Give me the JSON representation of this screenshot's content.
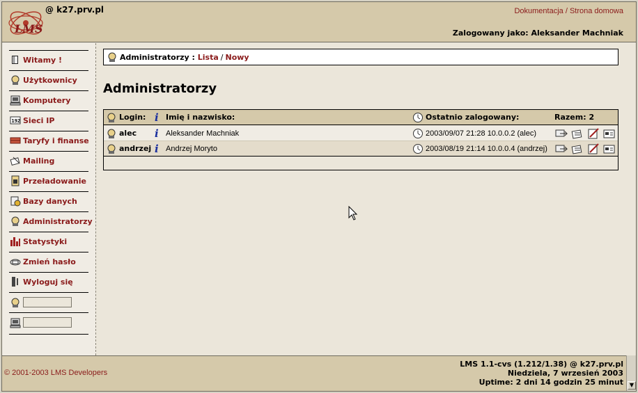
{
  "header": {
    "hostname": "@ k27.prv.pl",
    "links": [
      {
        "label": "Dokumentacja"
      },
      {
        "label": "Strona domowa"
      }
    ],
    "separator": "/",
    "logged_in": "Zalogowany jako: Aleksander Machniak",
    "logo_text": "LMS"
  },
  "sidebar": {
    "items": [
      {
        "label": "Witamy !",
        "icon": "book-icon"
      },
      {
        "label": "Użytkownicy",
        "icon": "user-icon"
      },
      {
        "label": "Komputery",
        "icon": "computer-icon"
      },
      {
        "label": "Sieci IP",
        "icon": "network-icon"
      },
      {
        "label": "Taryfy i finanse",
        "icon": "money-icon"
      },
      {
        "label": "Mailing",
        "icon": "mail-icon"
      },
      {
        "label": "Przeładowanie",
        "icon": "reload-icon"
      },
      {
        "label": "Bazy danych",
        "icon": "database-icon"
      },
      {
        "label": "Administratorzy",
        "icon": "admin-icon"
      },
      {
        "label": "Statystyki",
        "icon": "chart-icon"
      },
      {
        "label": "Zmień hasło",
        "icon": "password-icon"
      },
      {
        "label": "Wyloguj się",
        "icon": "logout-icon"
      }
    ],
    "quick_search": [
      {
        "icon": "user-icon",
        "value": ""
      },
      {
        "icon": "computer-icon",
        "value": ""
      }
    ]
  },
  "breadcrumb": {
    "section": "Administratorzy :",
    "links": [
      {
        "label": "Lista"
      },
      {
        "label": "Nowy"
      }
    ],
    "separator": "/"
  },
  "page_title": "Administratorzy",
  "table": {
    "headers": {
      "login": "Login:",
      "name": "Imię i nazwisko:",
      "last_login": "Ostatnio zalogowany:",
      "total": "Razem: 2"
    },
    "rows": [
      {
        "login": "alec",
        "name": "Aleksander Machniak",
        "last_login": "2003/09/07 21:28 10.0.0.2 (alec)"
      },
      {
        "login": "andrzej",
        "name": "Andrzej Moryto",
        "last_login": "2003/08/19 21:14 10.0.0.4 (andrzej)"
      }
    ],
    "info_glyph": "i"
  },
  "footer": {
    "copyright": "© 2001-2003 LMS Developers",
    "version": "LMS 1.1-cvs (1.212/1.38) @ k27.prv.pl",
    "date": "Niedziela, 7 wrzesień 2003",
    "uptime": "Uptime: 2 dni 14 godzin 25 minut"
  },
  "colors": {
    "header_bg": "#d5c9aa",
    "link": "#8a1a1a",
    "content_bg": "#ebe6da",
    "info_icon": "#1a2f9e"
  }
}
